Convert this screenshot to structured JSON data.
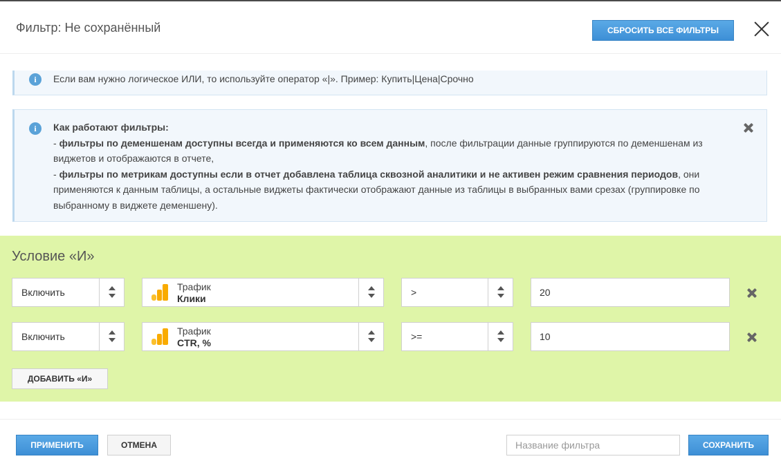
{
  "header": {
    "title": "Фильтр: Не сохранённый",
    "reset_label": "СБРОСИТЬ ВСЕ ФИЛЬТРЫ"
  },
  "info_or": {
    "text": "Если вам нужно логическое ИЛИ, то используйте оператор «|». Пример: Купить|Цена|Срочно"
  },
  "info_how": {
    "title": "Как работают фильтры:",
    "dash1": "- ",
    "bold1": "фильтры по деменшенам доступны всегда и применяются ко всем данным",
    "text1": ", после фильтрации данные группируются по деменшенам из виджетов и отображаются в отчете,",
    "dash2": "- ",
    "bold2": "фильтры по метрикам доступны если в отчет добавлена таблица сквозной аналитики и не активен режим сравнения периодов",
    "text2": ", они применяются к данным таблицы, а остальные виджеты фактически отображают данные из таблицы в выбранных вами срезах (группировке по выбранному в виджете деменшену)."
  },
  "condition": {
    "title": "Условие «И»",
    "rows": [
      {
        "mode": "Включить",
        "source": "Трафик",
        "metric": "Клики",
        "operator": ">",
        "value": "20"
      },
      {
        "mode": "Включить",
        "source": "Трафик",
        "metric": "CTR, %",
        "operator": ">=",
        "value": "10"
      }
    ],
    "add_label": "ДОБАВИТЬ «И»"
  },
  "footer": {
    "apply_label": "ПРИМЕНИТЬ",
    "cancel_label": "ОТМЕНА",
    "name_placeholder": "Название фильтра",
    "save_label": "СОХРАНИТЬ"
  },
  "icons": {
    "info": "info-circle-icon",
    "close": "close-icon",
    "delete": "delete-x-icon",
    "metric": "google-analytics-bars-icon",
    "select_arrows": "up-down-arrows-icon"
  },
  "colors": {
    "accent_blue": "#3d8fd6",
    "condition_bg": "#dff5a8",
    "info_bg": "#f2f7fc",
    "ga_orange": "#f9ab00",
    "ga_yellow": "#fbc02d"
  }
}
